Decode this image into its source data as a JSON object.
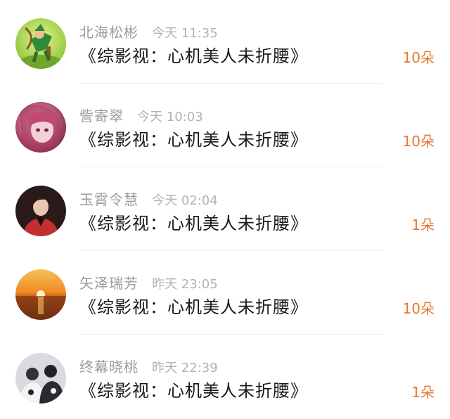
{
  "items": [
    {
      "name": "北海松彬",
      "time": "今天 11:35",
      "title": "《综影视：心机美人未折腰》",
      "count": "10朵",
      "avatar": "cartoon-archer"
    },
    {
      "name": "訾寄翠",
      "time": "今天 10:03",
      "title": "《综影视：心机美人未折腰》",
      "count": "10朵",
      "avatar": "anime-girl-pink"
    },
    {
      "name": "玉霄令慧",
      "time": "今天 02:04",
      "title": "《综影视：心机美人未折腰》",
      "count": "1朵",
      "avatar": "man-red-jacket"
    },
    {
      "name": "矢泽瑞芳",
      "time": "昨天 23:05",
      "title": "《综影视：心机美人未折腰》",
      "count": "10朵",
      "avatar": "sunset-sea"
    },
    {
      "name": "终幕晓桃",
      "time": "昨天 22:39",
      "title": "《综影视：心机美人未折腰》",
      "count": "1朵",
      "avatar": "couple-black-white"
    }
  ],
  "colors": {
    "count": "#e8772e",
    "name": "#9b9b9b",
    "title": "#1a1a1a"
  }
}
